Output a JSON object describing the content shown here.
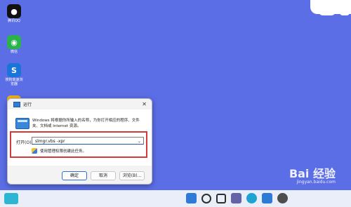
{
  "desktop": {
    "icons": [
      {
        "label": "腾讯QQ",
        "color": "#111111"
      },
      {
        "label": "微信",
        "color": "#2bb24c"
      },
      {
        "label": "搜狗高速浏览器",
        "color": "#1a74d9"
      },
      {
        "label": "",
        "color": "#f0b21a"
      }
    ]
  },
  "dialog": {
    "title": "运行",
    "close_label": "✕",
    "description": "Windows 将根据你所输入的名称，为你打开相应的程序、文件夹、文档或 Internet 资源。",
    "open_label": "打开(O):",
    "command_value": "slmgr.vbs -xpr",
    "admin_note": "使用管理权限创建此任务。",
    "buttons": {
      "ok": "确定",
      "cancel": "取消",
      "browse": "浏览(B)..."
    }
  },
  "watermark": {
    "brand": "Bai 经验",
    "url": "jingyan.baidu.com"
  },
  "taskbar": {
    "icons": [
      {
        "name": "start-icon",
        "color": "#2d7bd6"
      },
      {
        "name": "search-icon",
        "color": "#2d2d2d"
      },
      {
        "name": "task-view-icon",
        "color": "#2d2d2d"
      },
      {
        "name": "chat-icon",
        "color": "#6264a7"
      },
      {
        "name": "edge-icon",
        "color": "#1fa3d3"
      },
      {
        "name": "store-icon",
        "color": "#2d7bd6"
      },
      {
        "name": "settings-icon",
        "color": "#4d4d4d"
      }
    ]
  }
}
